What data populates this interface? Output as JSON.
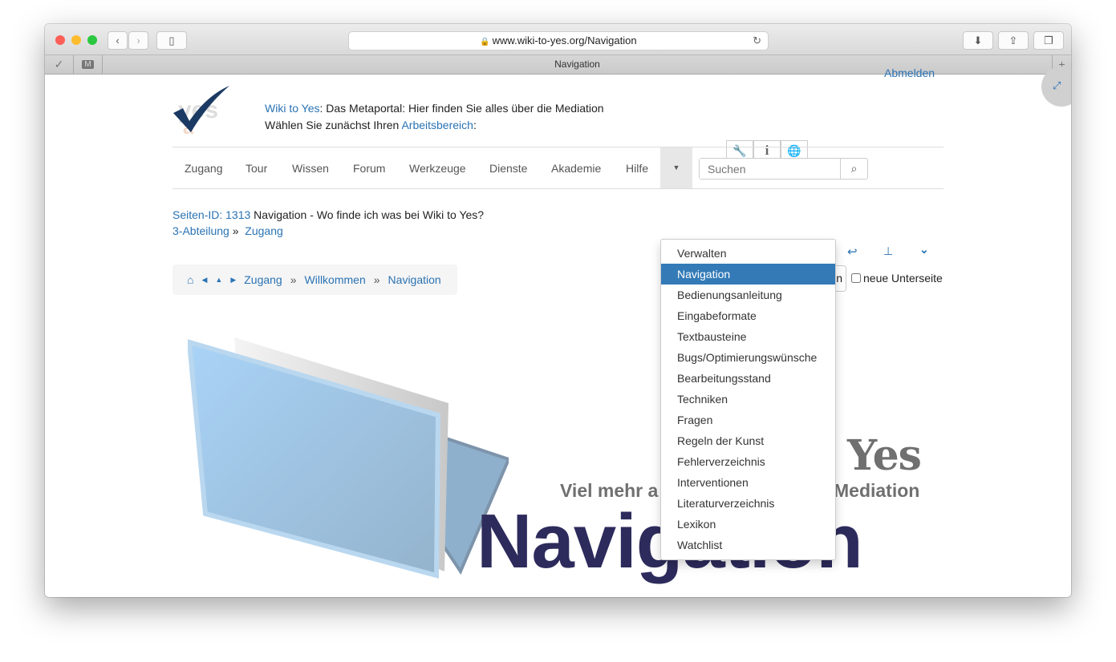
{
  "browser": {
    "url": "www.wiki-to-yes.org/Navigation",
    "tab_title": "Navigation",
    "pinned_tab_label": "M"
  },
  "header": {
    "site_link": "Wiki to Yes",
    "tagline": ": Das Metaportal: Hier finden Sie alles über die Mediation",
    "line2_prefix": "Wählen Sie zunächst Ihren ",
    "line2_link": "Arbeitsbereich",
    "line2_suffix": ":",
    "logout": "Abmelden"
  },
  "nav": {
    "items": [
      "Zugang",
      "Tour",
      "Wissen",
      "Forum",
      "Werkzeuge",
      "Dienste",
      "Akademie",
      "Hilfe"
    ],
    "search_placeholder": "Suchen"
  },
  "dropdown": {
    "items": [
      "Verwalten",
      "Navigation",
      "Bedienungsanleitung",
      "Eingabeformate",
      "Textbausteine",
      "Bugs/Optimierungswünsche",
      "Bearbeitungsstand",
      "Techniken",
      "Fragen",
      "Regeln der Kunst",
      "Fehlerverzeichnis",
      "Interventionen",
      "Literaturverzeichnis",
      "Lexikon",
      "Watchlist"
    ],
    "active": "Navigation"
  },
  "page": {
    "id_label": "Seiten-ID: 1313",
    "title": " Navigation - Wo finde ich was bei Wiki to Yes?",
    "crumb1": "3-Abteilung",
    "crumb_sep": "»",
    "crumb2": "Zugang",
    "new_subpage": "neue Unterseite",
    "input_partial": "n"
  },
  "breadcrumb": {
    "items": [
      "Zugang",
      "Willkommen",
      "Navigation"
    ],
    "sep": "»"
  },
  "banner": {
    "yes": "Yes",
    "sub_left": "Viel mehr a",
    "sub_right": "Mediation",
    "big": "Navigation"
  },
  "colors": {
    "link": "#2a73b4",
    "active": "#337ab7",
    "banner_title": "#2d2b5c"
  }
}
